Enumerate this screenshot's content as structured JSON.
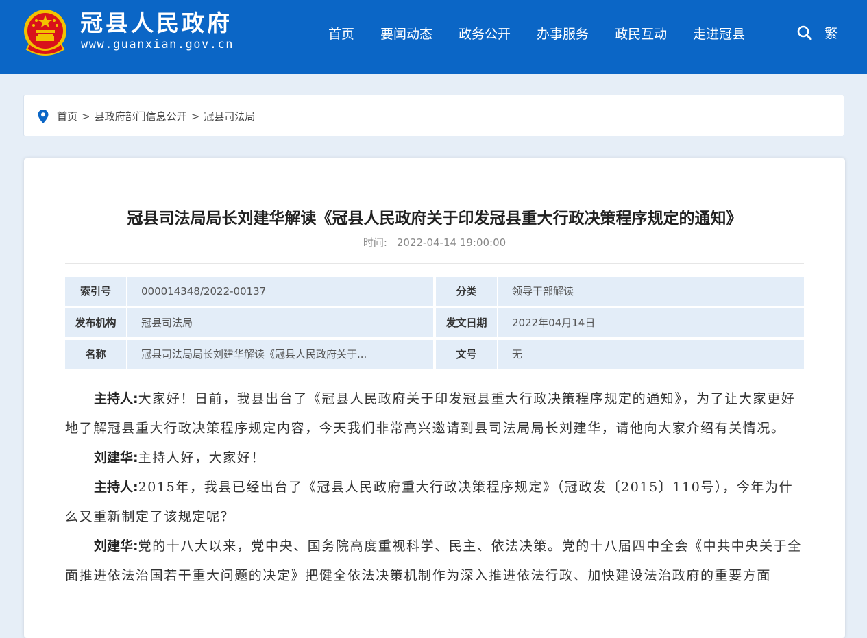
{
  "header": {
    "site_name": "冠县人民政府",
    "site_url": "www.guanxian.gov.cn",
    "nav": [
      "首页",
      "要闻动态",
      "政务公开",
      "办事服务",
      "政民互动",
      "走进冠县"
    ],
    "traditional_toggle": "繁",
    "icons": [
      "national-emblem",
      "search-icon"
    ]
  },
  "breadcrumb": {
    "icon": "location-icon",
    "items": [
      "首页",
      "县政府部门信息公开",
      "冠县司法局"
    ],
    "separator": ">"
  },
  "article": {
    "title": "冠县司法局局长刘建华解读《冠县人民政府关于印发冠县重大行政决策程序规定的通知》",
    "time_label": "时间:",
    "time_value": "2022-04-14 19:00:00",
    "meta": {
      "index_no_label": "索引号",
      "index_no": "000014348/2022-00137",
      "category_label": "分类",
      "category": "领导干部解读",
      "publisher_label": "发布机构",
      "publisher": "冠县司法局",
      "date_label": "发文日期",
      "date": "2022年04月14日",
      "name_label": "名称",
      "name": "冠县司法局局长刘建华解读《冠县人民政府关于...",
      "doc_no_label": "文号",
      "doc_no": "无"
    },
    "paragraphs": [
      {
        "speaker": "主持人:",
        "text": "大家好！日前，我县出台了《冠县人民政府关于印发冠县重大行政决策程序规定的通知》，为了让大家更好地了解冠县重大行政决策程序规定内容，今天我们非常高兴邀请到县司法局局长刘建华，请他向大家介绍有关情况。"
      },
      {
        "speaker": "刘建华:",
        "text": "主持人好，大家好！"
      },
      {
        "speaker": "主持人:",
        "text": "2015年，我县已经出台了《冠县人民政府重大行政决策程序规定》（冠政发〔2015〕110号），今年为什么又重新制定了该规定呢？"
      },
      {
        "speaker": "刘建华:",
        "text": "党的十八大以来，党中央、国务院高度重视科学、民主、依法决策。党的十八届四中全会《中共中央关于全面推进依法治国若干重大问题的决定》把健全依法决策机制作为深入推进依法行政、加快建设法治政府的重要方面"
      }
    ]
  },
  "colors": {
    "header_bg": "#0b66c6",
    "page_bg": "#e6eef7",
    "meta_cell_bg": "#e3edf8",
    "emblem_red": "#d8121b",
    "emblem_gold": "#f2c200"
  }
}
